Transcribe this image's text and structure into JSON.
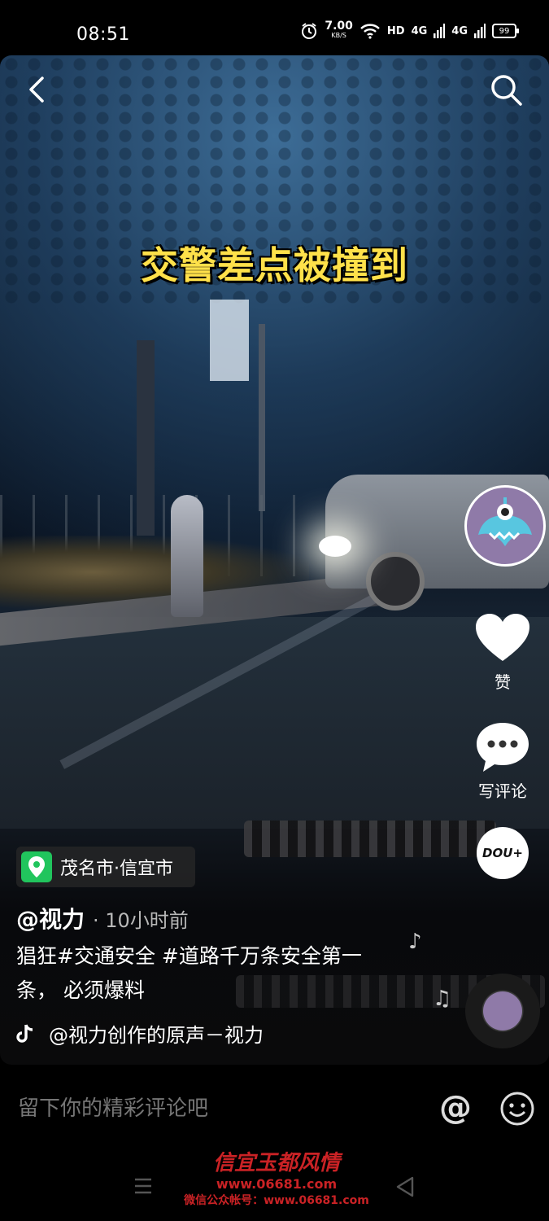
{
  "status_bar": {
    "time": "08:51",
    "net_speed": "7.00",
    "net_unit": "KB/S",
    "hd": "HD",
    "signal1": "4G",
    "signal2": "4G",
    "battery": "99"
  },
  "video": {
    "caption": "交警差点被撞到"
  },
  "actions": {
    "like_label": "赞",
    "comment_label": "写评论",
    "dou_label": "DOU+"
  },
  "post": {
    "location": "茂名市·信宜市",
    "author": "@视力",
    "time_ago": "· 10小时前",
    "description": "猖狂#交通安全 #道路千万条安全第一条， 必须爆料",
    "music": "@视力创作的原声－视力"
  },
  "comment": {
    "placeholder": "留下你的精彩评论吧",
    "at_symbol": "@"
  },
  "watermark": {
    "title": "信宜玉都风情",
    "url": "www.06681.com",
    "sub": "微信公众帐号：www.06681.com"
  },
  "colors": {
    "caption": "#ffe14a",
    "location_icon": "#21c55d",
    "watermark": "#e0262a"
  }
}
